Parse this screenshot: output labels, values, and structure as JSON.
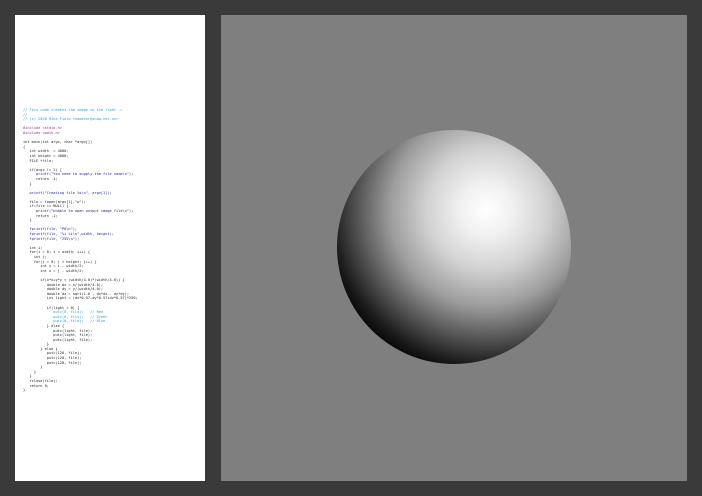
{
  "code_lines": [
    {
      "text": "// This code creates the image to the right ->",
      "cls": "c-comment"
    },
    {
      "text": "//",
      "cls": "c-comment"
    },
    {
      "text": "// (c) 2020 Mike Field <hamster@snap.net.nz>",
      "cls": "c-comment"
    },
    {
      "text": "",
      "cls": ""
    },
    {
      "text": "#include <stdio.h>",
      "cls": "c-pre"
    },
    {
      "text": "#include <math.h>",
      "cls": "c-pre"
    },
    {
      "text": "",
      "cls": ""
    },
    {
      "text": "int main(int argc, char *argv[])",
      "cls": "c-kw"
    },
    {
      "text": "{",
      "cls": "c-kw"
    },
    {
      "text": "   int width  = 4000;",
      "cls": "c-kw"
    },
    {
      "text": "   int height = 4000;",
      "cls": "c-kw"
    },
    {
      "text": "   FILE *file;",
      "cls": "c-kw"
    },
    {
      "text": "",
      "cls": ""
    },
    {
      "text": "   if(argc != 2) {",
      "cls": "c-kw"
    },
    {
      "text": "      printf(\"You need to supply the file name\\n\");",
      "cls": "c-str"
    },
    {
      "text": "      return -1;",
      "cls": "c-kw"
    },
    {
      "text": "   }",
      "cls": "c-kw"
    },
    {
      "text": "",
      "cls": ""
    },
    {
      "text": "   printf(\"Creating file %s\\n\", argv[1]);",
      "cls": "c-str"
    },
    {
      "text": "",
      "cls": ""
    },
    {
      "text": "   file = fopen(argv[1],\"w\");",
      "cls": "c-kw"
    },
    {
      "text": "   if(file == NULL) {",
      "cls": "c-kw"
    },
    {
      "text": "      printf(\"Unable to open output image file\\n\");",
      "cls": "c-str"
    },
    {
      "text": "      return -1;",
      "cls": "c-kw"
    },
    {
      "text": "   }",
      "cls": "c-kw"
    },
    {
      "text": "",
      "cls": ""
    },
    {
      "text": "   fprintf(file, \"P6\\n\");",
      "cls": "c-str"
    },
    {
      "text": "   fprintf(file, \"%i %i\\n\",width, height);",
      "cls": "c-str"
    },
    {
      "text": "   fprintf(file, \"255\\n\");",
      "cls": "c-str"
    },
    {
      "text": "",
      "cls": ""
    },
    {
      "text": "   int i;",
      "cls": "c-kw"
    },
    {
      "text": "   for(i = 0; i < width; i++) {",
      "cls": "c-kw"
    },
    {
      "text": "     int j;",
      "cls": "c-kw"
    },
    {
      "text": "     for(j = 0; j < height; j++) {",
      "cls": "c-kw"
    },
    {
      "text": "        int y = i - width/2;",
      "cls": "c-kw"
    },
    {
      "text": "        int x = j - width/2;",
      "cls": "c-kw"
    },
    {
      "text": "",
      "cls": ""
    },
    {
      "text": "        if(x*x+y*y < (width/4.0)*(width/4.0)) {",
      "cls": "c-kw"
    },
    {
      "text": "           double dx = x/(width/4.0);",
      "cls": "c-kw"
    },
    {
      "text": "           double dy = y/(width/4.0);",
      "cls": "c-kw"
    },
    {
      "text": "           double dz = sqrt(1.0 - dx*dx - dy*dy);",
      "cls": "c-kw"
    },
    {
      "text": "           int light = (dx*0.57-dy*0.57+dz*0.57)*256;",
      "cls": "c-kw"
    },
    {
      "text": "",
      "cls": ""
    },
    {
      "text": "           if(light < 0) {",
      "cls": "c-kw"
    },
    {
      "text": "              putc(0, file);   // Red",
      "cls": "c-comment"
    },
    {
      "text": "              putc(0, file);   // Green",
      "cls": "c-comment"
    },
    {
      "text": "              putc(0, file);   // Blue",
      "cls": "c-comment"
    },
    {
      "text": "           } else {",
      "cls": "c-kw"
    },
    {
      "text": "              putc(light, file);",
      "cls": "c-kw"
    },
    {
      "text": "              putc(light, file);",
      "cls": "c-kw"
    },
    {
      "text": "              putc(light, file);",
      "cls": "c-kw"
    },
    {
      "text": "           }",
      "cls": "c-kw"
    },
    {
      "text": "        } else {",
      "cls": "c-kw"
    },
    {
      "text": "           putc(128, file);",
      "cls": "c-kw"
    },
    {
      "text": "           putc(128, file);",
      "cls": "c-kw"
    },
    {
      "text": "           putc(128, file);",
      "cls": "c-kw"
    },
    {
      "text": "        }",
      "cls": "c-kw"
    },
    {
      "text": "     }",
      "cls": "c-kw"
    },
    {
      "text": "   }",
      "cls": "c-kw"
    },
    {
      "text": "   fclose(file);",
      "cls": "c-kw"
    },
    {
      "text": "   return 0;",
      "cls": "c-kw"
    },
    {
      "text": "}",
      "cls": "c-kw"
    }
  ],
  "colors": {
    "background": "#3a3a3a",
    "paper": "#ffffff",
    "canvas_gray": "#7f7f7f",
    "comment": "#1f9fd6",
    "preprocessor": "#a0308c",
    "string": "#1a1a8c"
  },
  "sphere_shading": "diffuse lit sphere, light from upper right"
}
